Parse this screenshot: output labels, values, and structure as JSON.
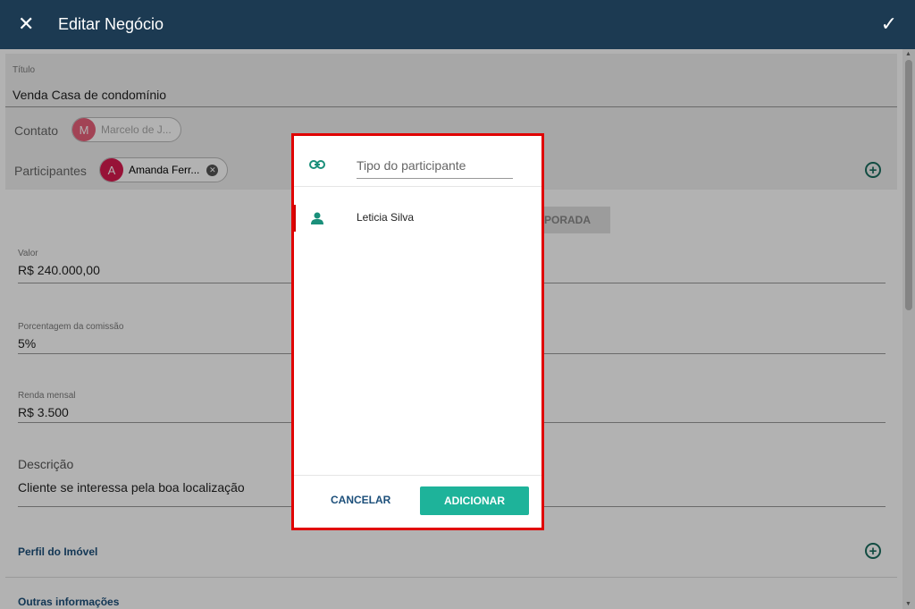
{
  "header": {
    "title": "Editar Negócio",
    "close_icon": "close-icon",
    "confirm_icon": "check-icon",
    "close_glyph": "✕",
    "confirm_glyph": "✓"
  },
  "form": {
    "titulo": {
      "label": "Título",
      "value": "Venda Casa de condomínio"
    },
    "contato": {
      "label": "Contato",
      "chip_initial": "M",
      "chip_text": "Marcelo de J...",
      "chip_color": "#e8607a"
    },
    "participantes": {
      "label": "Participantes",
      "chip_initial": "A",
      "chip_text": "Amanda Ferr...",
      "chip_color": "#d81b50"
    },
    "ghost_button_fragment": "MPORADA",
    "valor": {
      "label": "Valor",
      "value": "R$ 240.000,00"
    },
    "comissao": {
      "label": "Porcentagem da comissão",
      "value": "5%"
    },
    "renda": {
      "label": "Renda mensal",
      "value": "R$ 3.500"
    },
    "descricao": {
      "label": "Descrição",
      "value": "Cliente se interessa pela boa localização"
    },
    "perfil_imovel": "Perfil do Imóvel",
    "outras_informacoes": "Outras informações"
  },
  "dialog": {
    "type_placeholder": "Tipo do participante",
    "type_value": "",
    "participants": [
      {
        "name": "Leticia Silva",
        "icon": "person-icon"
      }
    ],
    "cancel_label": "CANCELAR",
    "add_label": "ADICIONAR"
  },
  "colors": {
    "header_bg": "#1c3a52",
    "accent_green": "#1eb39a",
    "link_blue": "#1c4f7a",
    "highlight_border": "#e00000"
  }
}
